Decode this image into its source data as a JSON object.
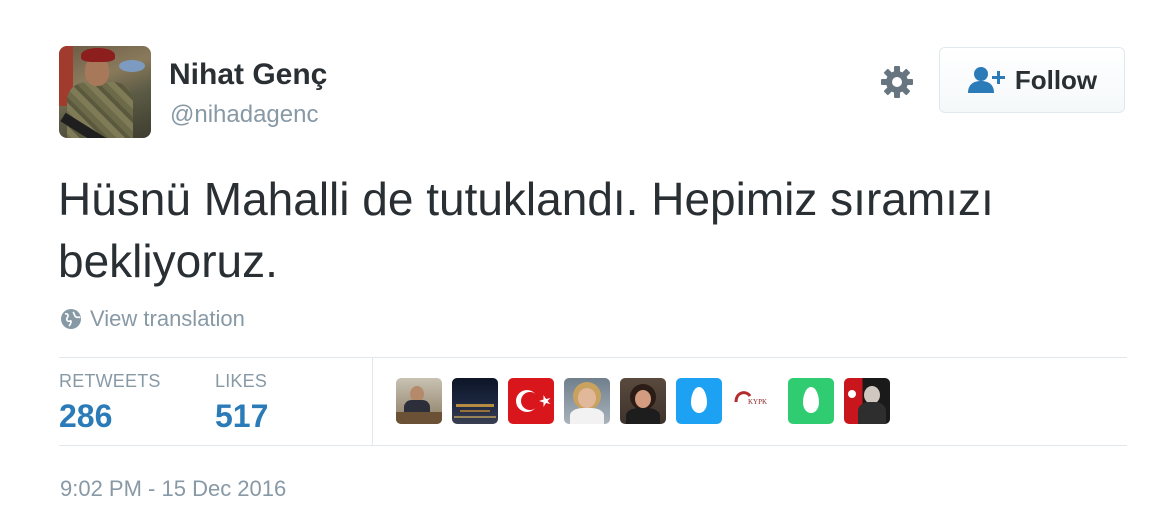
{
  "user": {
    "display_name": "Nihat Genç",
    "screen_name": "@nihadagenc",
    "avatar": "soldier-avatar"
  },
  "actions": {
    "settings_icon": "gear-icon",
    "follow_label": "Follow",
    "follow_icon": "user-plus-icon"
  },
  "tweet": {
    "text": "Hüsnü Mahalli de tutuklandı. Hepimiz sıramızı bekliyoruz.",
    "translate_icon": "globe-icon",
    "translate_label": "View translation",
    "timestamp": "9:02 PM - 15 Dec 2016"
  },
  "stats": {
    "retweets_label": "RETWEETS",
    "retweets_value": "286",
    "likes_label": "LIKES",
    "likes_value": "517"
  },
  "likers": [
    "liker-avatar-man-at-desk",
    "liker-avatar-city-night",
    "liker-avatar-turkish-flag",
    "liker-avatar-woman-blonde",
    "liker-avatar-woman-dark-hair",
    "liker-avatar-default-egg-blue",
    "liker-avatar-logo",
    "liker-avatar-default-egg-green",
    "liker-avatar-ataturk-flag"
  ],
  "colors": {
    "link": "#2b7bb9",
    "muted": "#8899a6",
    "text": "#292f33",
    "border": "#e1e8ed"
  }
}
